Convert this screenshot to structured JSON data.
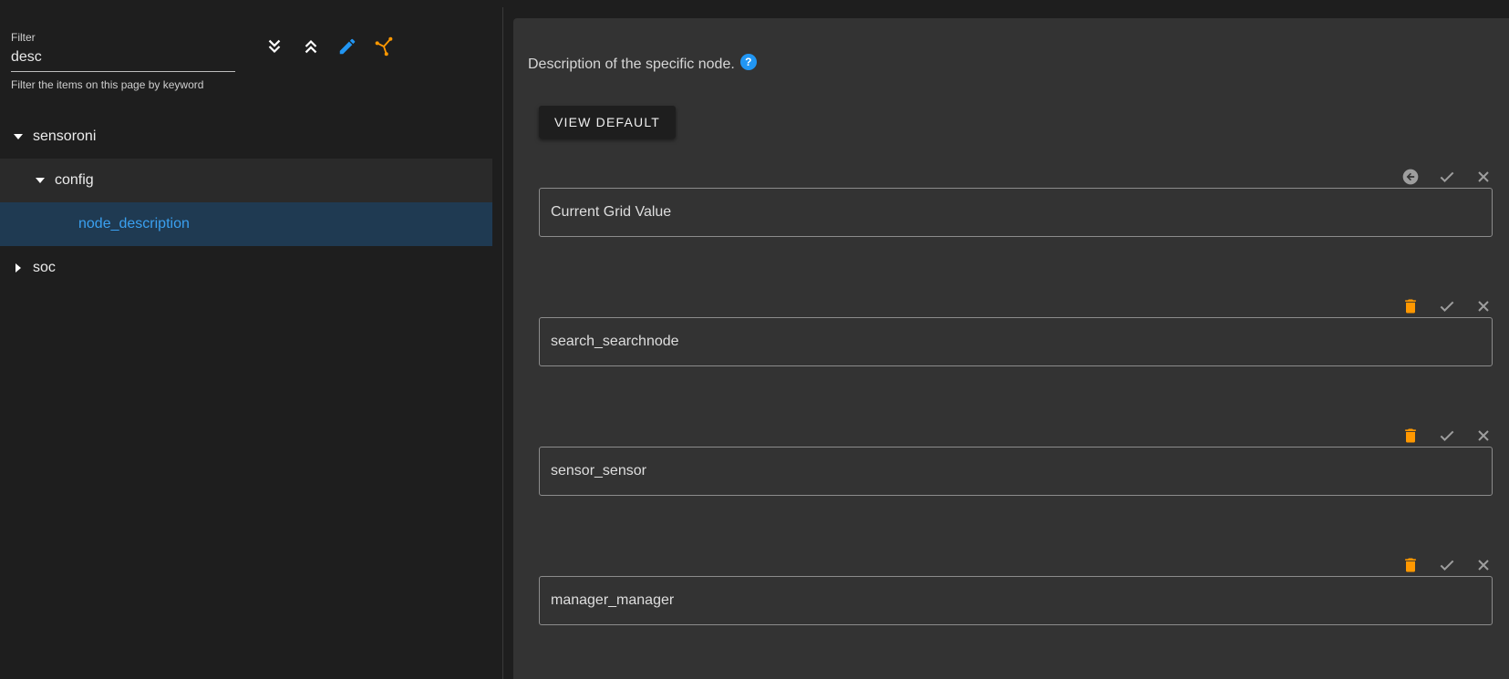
{
  "filter": {
    "label": "Filter",
    "value": "desc",
    "hint": "Filter the items on this page by keyword"
  },
  "toolbar": {
    "expand_all_icon": "double-chevron-down-icon",
    "collapse_all_icon": "double-chevron-up-icon",
    "edit_icon": "pencil-icon",
    "advanced_icon": "graph-icon",
    "colors": {
      "default": "#ffffff",
      "edit": "#2196f3",
      "advanced": "#ff9800"
    }
  },
  "tree": [
    {
      "label": "sensoroni",
      "level": 0,
      "expanded": true
    },
    {
      "label": "config",
      "level": 1,
      "expanded": true
    },
    {
      "label": "node_description",
      "level": 2,
      "selected": true
    },
    {
      "label": "soc",
      "level": 0,
      "expanded": false
    }
  ],
  "detail": {
    "description": "Description of the specific node.",
    "help_icon": "?",
    "view_default_label": "VIEW DEFAULT",
    "fields": [
      {
        "value": "Current Grid Value",
        "first_action": "revert-icon"
      },
      {
        "value": "search_searchnode",
        "first_action": "trash-icon"
      },
      {
        "value": "sensor_sensor",
        "first_action": "trash-icon"
      },
      {
        "value": "manager_manager",
        "first_action": "trash-icon"
      }
    ],
    "colors": {
      "trash": "#ff9800",
      "muted": "#9e9e9e"
    }
  }
}
